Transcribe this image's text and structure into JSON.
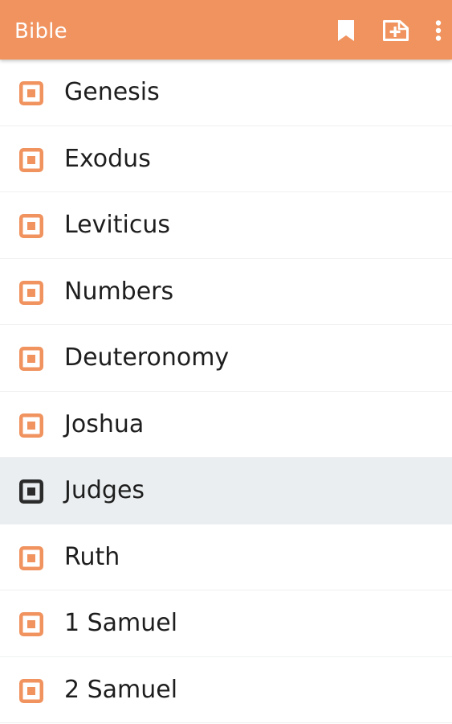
{
  "app_bar": {
    "title": "Bible",
    "background_color": "#f0935f",
    "actions": [
      {
        "icon": "bookmark-icon"
      },
      {
        "icon": "add-note-icon"
      },
      {
        "icon": "more-vert-icon"
      }
    ]
  },
  "colors": {
    "accent": "#f0935f",
    "selected_icon": "#2b2b2b",
    "selected_row": "#eaeef0"
  },
  "books": [
    {
      "name": "Genesis",
      "selected": false
    },
    {
      "name": "Exodus",
      "selected": false
    },
    {
      "name": "Leviticus",
      "selected": false
    },
    {
      "name": "Numbers",
      "selected": false
    },
    {
      "name": "Deuteronomy",
      "selected": false
    },
    {
      "name": "Joshua",
      "selected": false
    },
    {
      "name": "Judges",
      "selected": true
    },
    {
      "name": "Ruth",
      "selected": false
    },
    {
      "name": "1 Samuel",
      "selected": false
    },
    {
      "name": "2 Samuel",
      "selected": false
    }
  ]
}
